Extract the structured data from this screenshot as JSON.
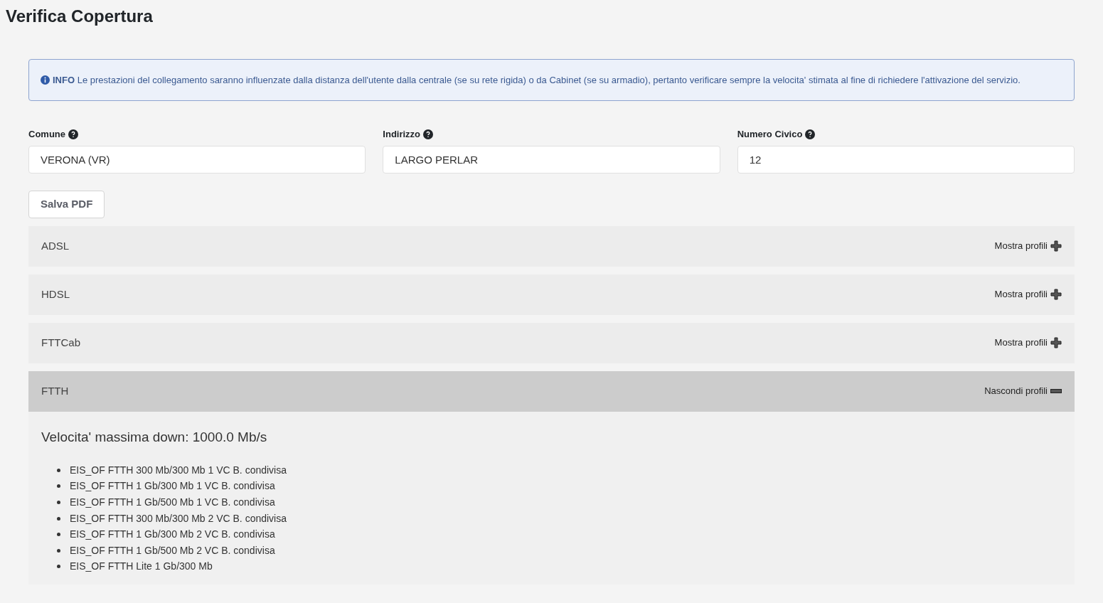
{
  "page_title": "Verifica Copertura",
  "info": {
    "label": "INFO",
    "text": "Le prestazioni del collegamento saranno influenzate dalla distanza dell'utente dalla centrale (se su rete rigida) o da Cabinet (se su armadio), pertanto verificare sempre la velocita' stimata al fine di richiedere l'attivazione del servizio."
  },
  "fields": [
    {
      "label": "Comune",
      "value": "VERONA (VR)"
    },
    {
      "label": "Indirizzo",
      "value": "LARGO PERLAR"
    },
    {
      "label": "Numero Civico",
      "value": "12"
    }
  ],
  "save_button": "Salva PDF",
  "sections": [
    {
      "name": "ADSL",
      "toggle": "Mostra profili",
      "expanded": false
    },
    {
      "name": "HDSL",
      "toggle": "Mostra profili",
      "expanded": false
    },
    {
      "name": "FTTCab",
      "toggle": "Mostra profili",
      "expanded": false
    },
    {
      "name": "FTTH",
      "toggle": "Nascondi profili",
      "expanded": true,
      "max_speed": "Velocita' massima down: 1000.0 Mb/s",
      "profiles": [
        "EIS_OF FTTH 300 Mb/300 Mb 1 VC B. condivisa",
        "EIS_OF FTTH 1 Gb/300 Mb 1 VC B. condivisa",
        "EIS_OF FTTH 1 Gb/500 Mb 1 VC B. condivisa",
        "EIS_OF FTTH 300 Mb/300 Mb 2 VC B. condivisa",
        "EIS_OF FTTH 1 Gb/300 Mb 2 VC B. condivisa",
        "EIS_OF FTTH 1 Gb/500 Mb 2 VC B. condivisa",
        "EIS_OF FTTH Lite 1 Gb/300 Mb"
      ]
    }
  ]
}
